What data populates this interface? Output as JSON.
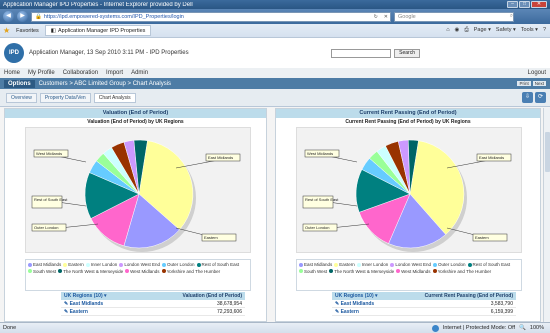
{
  "window": {
    "title": "Application Manager IPD Properties - Internet Explorer provided by Dell",
    "minimize": "–",
    "maximize": "□",
    "close": "✕"
  },
  "browser": {
    "url": "https://ipd.empowered-systems.com/IPD_Properties/login",
    "search_placeholder": "Google",
    "favorites_label": "Favorites",
    "tab_label": "Application Manager IPD Properties",
    "commands": [
      "Page ▾",
      "Safety ▾",
      "Tools ▾"
    ]
  },
  "app": {
    "logo": "IPD",
    "header_title": "Application Manager, 13 Sep 2010 3:11 PM - IPD Properties",
    "search_button": "Search",
    "menu": [
      "Home",
      "My Profile",
      "Collaboration",
      "Import",
      "Admin"
    ],
    "logout": "Logout",
    "options_label": "Options",
    "breadcrumb": "Customers > ABC Limited Group > Chart Analysis",
    "right_buttons": [
      "Print",
      "Next"
    ],
    "tabs": [
      "Overview",
      "Property Data/Ven",
      "Chart Analysis"
    ]
  },
  "panels": [
    {
      "header": "Valuation (End of Period)",
      "chart_title": "Valuation (End of Period) by UK Regions",
      "table_header": [
        "UK Regions (10) ▾",
        "Valuation (End of Period)"
      ],
      "rows": [
        {
          "region": "East Midlands",
          "value": "38,678,954"
        },
        {
          "region": "Eastern",
          "value": "72,293,606"
        }
      ]
    },
    {
      "header": "Current Rent Passing (End of Period)",
      "chart_title": "Current Rent Passing (End of Period) by UK Regions",
      "table_header": [
        "UK Regions (10) ▾",
        "Current Rent Passing (End of Period)"
      ],
      "rows": [
        {
          "region": "East Midlands",
          "value": "3,583,790"
        },
        {
          "region": "Eastern",
          "value": "6,159,399"
        }
      ]
    }
  ],
  "chart_data": [
    {
      "type": "pie",
      "title": "Valuation (End of Period) by UK Regions",
      "categories": [
        "Eastern",
        "East Midlands",
        "West Midlands",
        "Rest of South East",
        "Outer London",
        "South West",
        "Inner London",
        "Yorkshire and The Humber",
        "London West End",
        "The North West & Merseyside"
      ],
      "values": [
        34,
        18,
        13,
        14,
        4,
        3,
        3,
        4,
        3,
        4
      ],
      "callouts": [
        "West Midlands",
        "East Midlands",
        "Rest of South East",
        "Outer London",
        "Eastern"
      ],
      "colors": [
        "#ffff99",
        "#9999ff",
        "#ff66cc",
        "#008080",
        "#66ccff",
        "#99ff99",
        "#ccffff",
        "#993300",
        "#cc99ff",
        "#006666"
      ]
    },
    {
      "type": "pie",
      "title": "Current Rent Passing (End of Period) by UK Regions",
      "categories": [
        "Eastern",
        "East Midlands",
        "West Midlands",
        "Rest of South East",
        "Outer London",
        "South West",
        "Inner London",
        "Yorkshire and The Humber",
        "London West End",
        "The North West & Merseyside"
      ],
      "values": [
        36,
        18,
        13,
        13,
        4,
        3,
        3,
        4,
        3,
        3
      ],
      "callouts": [
        "West Midlands",
        "East Midlands",
        "Rest of South East",
        "Outer London",
        "Eastern"
      ],
      "colors": [
        "#ffff99",
        "#9999ff",
        "#ff66cc",
        "#008080",
        "#66ccff",
        "#99ff99",
        "#ccffff",
        "#993300",
        "#cc99ff",
        "#006666"
      ]
    }
  ],
  "legend": [
    {
      "label": "East Midlands",
      "color": "#9999ff"
    },
    {
      "label": "Eastern",
      "color": "#ffff99"
    },
    {
      "label": "Inner London",
      "color": "#ccffff"
    },
    {
      "label": "London West End",
      "color": "#cc99ff"
    },
    {
      "label": "Outer London",
      "color": "#66ccff"
    },
    {
      "label": "Rest of South East",
      "color": "#008080"
    },
    {
      "label": "South West",
      "color": "#99ff99"
    },
    {
      "label": "The North West & Merseyside",
      "color": "#006666"
    },
    {
      "label": "West Midlands",
      "color": "#ff66cc"
    },
    {
      "label": "Yorkshire and The Humber",
      "color": "#993300"
    }
  ],
  "status": {
    "left": "Done",
    "zone": "Internet | Protected Mode: Off",
    "zoom": "100%"
  }
}
